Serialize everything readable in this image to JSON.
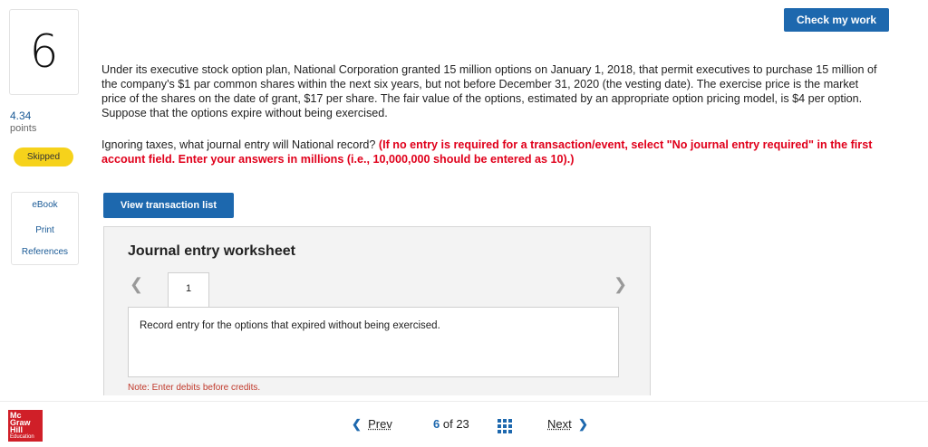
{
  "question": {
    "number": "6",
    "points_value": "4.34",
    "points_label": "points",
    "status": "Skipped",
    "text": "Under its executive stock option plan, National Corporation granted 15 million options on January 1, 2018, that permit executives to purchase 15 million of the company's $1 par common shares within the next six years, but not before December 31, 2020 (the vesting date). The exercise price is the market price of the shares on the date of grant, $17 per share. The fair value of the options, estimated by an appropriate option pricing model, is $4 per option. Suppose that the options expire without being exercised.",
    "instruction_plain": "Ignoring taxes, what journal entry will National record?",
    "instruction_red": "(If no entry is required for a transaction/event, select \"No journal entry required\" in the first account field. Enter your answers in millions (i.e., 10,000,000 should be entered as 10).)"
  },
  "side_links": [
    "eBook",
    "Print",
    "References"
  ],
  "header": {
    "check_button": "Check my work"
  },
  "worksheet": {
    "view_button": "View transaction list",
    "title": "Journal entry worksheet",
    "tab": "1",
    "entry_text": "Record entry for the options that expired without being exercised.",
    "note": "Note: Enter debits before credits."
  },
  "footer": {
    "logo_lines": [
      "Mc",
      "Graw",
      "Hill",
      "Education"
    ],
    "prev_label": "Prev",
    "current_page": "6",
    "of_label": "of 23",
    "next_label": "Next"
  },
  "colors": {
    "accent": "#1d68ae",
    "status": "#f6d21b",
    "warning": "#e0001b",
    "brand": "#d01f28"
  },
  "icons": [
    "chevron-left-icon",
    "chevron-right-icon",
    "grid-icon"
  ]
}
